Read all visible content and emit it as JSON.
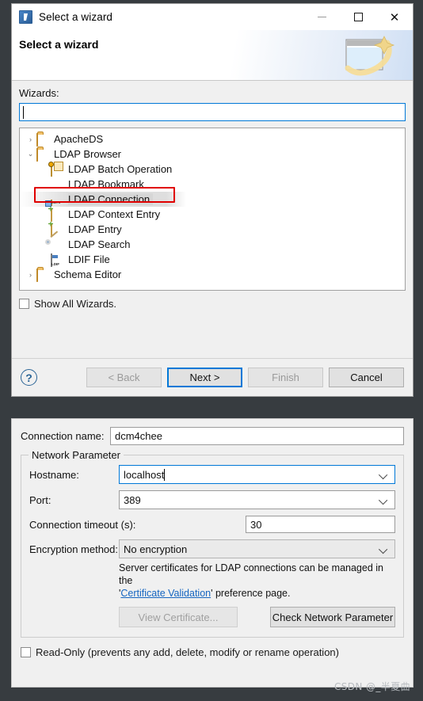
{
  "window": {
    "title": "Select a wizard",
    "icon": "wizard-icon",
    "minimize_label": "—",
    "maximize_label": "□",
    "close_label": "✕"
  },
  "banner": {
    "title": "Select a wizard",
    "art": "wizard-banner-art"
  },
  "wizard_page": {
    "filter_label": "Wizards:",
    "filter_value": "",
    "filter_placeholder": "",
    "show_all_label": "Show All Wizards.",
    "show_all_checked": false,
    "highlight_color": "#e00000"
  },
  "tree": {
    "items": [
      {
        "label": "ApacheDS",
        "icon": "folder-icon",
        "indent": 0,
        "twisty": "›",
        "expanded": false,
        "selected": false
      },
      {
        "label": "LDAP Browser",
        "icon": "folder-icon",
        "indent": 0,
        "twisty": "⌄",
        "expanded": true,
        "selected": false
      },
      {
        "label": "LDAP Batch Operation",
        "icon": "batch-operation-icon",
        "indent": 1,
        "twisty": "",
        "expanded": false,
        "selected": false
      },
      {
        "label": "LDAP Bookmark",
        "icon": "bookmark-icon",
        "indent": 1,
        "twisty": "",
        "expanded": false,
        "selected": false
      },
      {
        "label": "LDAP Connection",
        "icon": "ldap-connection-icon",
        "indent": 1,
        "twisty": "",
        "expanded": false,
        "selected": true
      },
      {
        "label": "LDAP Context Entry",
        "icon": "entry-icon",
        "indent": 1,
        "twisty": "",
        "expanded": false,
        "selected": false
      },
      {
        "label": "LDAP Entry",
        "icon": "entry-icon",
        "indent": 1,
        "twisty": "",
        "expanded": false,
        "selected": false
      },
      {
        "label": "LDAP Search",
        "icon": "search-icon",
        "indent": 1,
        "twisty": "",
        "expanded": false,
        "selected": false
      },
      {
        "label": "LDIF File",
        "icon": "ldif-file-icon",
        "indent": 1,
        "twisty": "",
        "expanded": false,
        "selected": false
      },
      {
        "label": "Schema Editor",
        "icon": "folder-icon",
        "indent": 0,
        "twisty": "›",
        "expanded": false,
        "selected": false
      }
    ]
  },
  "footer": {
    "help_label": "?",
    "back_label": "< Back",
    "next_label": "Next >",
    "finish_label": "Finish",
    "cancel_label": "Cancel",
    "default_button_color": "#0078d7"
  },
  "connection": {
    "name_label": "Connection name:",
    "name_value": "dcm4chee",
    "group_title": "Network Parameter",
    "hostname_label": "Hostname:",
    "hostname_value": "localhost",
    "port_label": "Port:",
    "port_value": "389",
    "timeout_label": "Connection timeout (s):",
    "timeout_value": "30",
    "encryption_label": "Encryption method:",
    "encryption_value": "No encryption",
    "hint_prefix": "Server certificates for LDAP connections can be managed in the",
    "hint_quote_open": "'",
    "hint_link": "Certificate Validation",
    "hint_quote_close": "'",
    "hint_suffix": " preference page.",
    "view_certificate_label": "View Certificate...",
    "check_network_label": "Check Network Parameter",
    "readonly_label": "Read-Only (prevents any add, delete, modify or rename operation)",
    "readonly_checked": false
  },
  "watermark": {
    "text": "CSDN @_半夏曲"
  }
}
